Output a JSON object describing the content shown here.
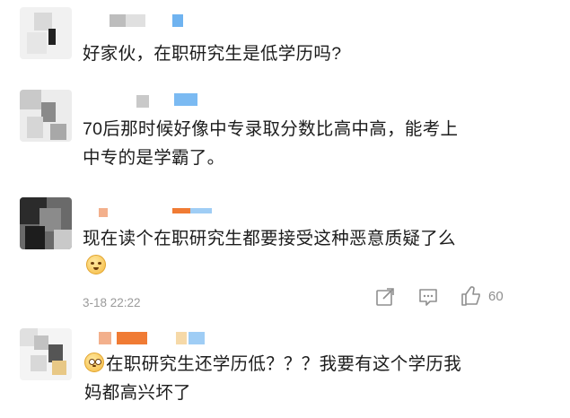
{
  "comments": [
    {
      "text": "好家伙，在职研究生是低学历吗?"
    },
    {
      "text_line1": "70后那时候好像中专录取分数比高中高，能考上",
      "text_line2": "中专的是学霸了。"
    },
    {
      "text": "现在读个在职研究生都要接受这种恶意质疑了么",
      "time": "3-18 22:22",
      "likes": "60",
      "icons": [
        "share-icon",
        "comment-icon",
        "like-icon"
      ]
    },
    {
      "text_line1": "在职研究生还学历低？？？我要有这个学历我",
      "text_line2": "妈都高兴坏了"
    }
  ],
  "colors": {
    "text": "#1c1c1c",
    "meta": "#9a9a9a",
    "name_blue": "#6fb3f0",
    "name_orange": "#f07b34"
  }
}
